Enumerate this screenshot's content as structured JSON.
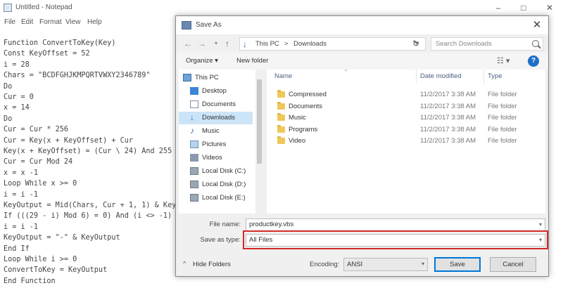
{
  "notepad": {
    "title": "Untitled - Notepad",
    "menu": [
      "File",
      "Edit",
      "Format",
      "View",
      "Help"
    ],
    "code_lines": [
      "Function ConvertToKey(Key)",
      "Const KeyOffset = 52",
      "i = 28",
      "Chars = \"BCDFGHJKMPQRTVWXY2346789\"",
      "Do",
      "Cur = 0",
      "x = 14",
      "Do",
      "Cur = Cur * 256",
      "Cur = Key(x + KeyOffset) + Cur",
      "Key(x + KeyOffset) = (Cur \\ 24) And 255",
      "Cur = Cur Mod 24",
      "x = x -1",
      "Loop While x >= 0",
      "i = i -1",
      "KeyOutput = Mid(Chars, Cur + 1, 1) & KeyOutput",
      "If (((29 - i) Mod 6) = 0) And (i <> -1) Then",
      "i = i -1",
      "KeyOutput = \"-\" & KeyOutput",
      "End If",
      "Loop While i >= 0",
      "ConvertToKey = KeyOutput",
      "End Function"
    ]
  },
  "dialog": {
    "title": "Save As",
    "address": {
      "crumbs": [
        "This PC",
        ">",
        "Downloads"
      ],
      "search_placeholder": "Search Downloads"
    },
    "toolbar": {
      "organize": "Organize ▾",
      "new_folder": "New folder",
      "help": "?"
    },
    "nav_items": [
      {
        "label": "This PC",
        "icon": "computer-icon",
        "selected": false
      },
      {
        "label": "Desktop",
        "icon": "desktop-icon",
        "selected": false
      },
      {
        "label": "Documents",
        "icon": "documents-icon",
        "selected": false
      },
      {
        "label": "Downloads",
        "icon": "download-icon",
        "selected": true
      },
      {
        "label": "Music",
        "icon": "music-icon",
        "selected": false
      },
      {
        "label": "Pictures",
        "icon": "pictures-icon",
        "selected": false
      },
      {
        "label": "Videos",
        "icon": "videos-icon",
        "selected": false
      },
      {
        "label": "Local Disk (C:)",
        "icon": "disk-icon",
        "selected": false
      },
      {
        "label": "Local Disk (D:)",
        "icon": "disk-icon",
        "selected": false
      },
      {
        "label": "Local Disk (E:)",
        "icon": "disk-icon",
        "selected": false
      }
    ],
    "columns": {
      "name": "Name",
      "date": "Date modified",
      "type": "Type"
    },
    "files": [
      {
        "name": "Compressed",
        "date": "11/2/2017 3:38 AM",
        "type": "File folder"
      },
      {
        "name": "Documents",
        "date": "11/2/2017 3:38 AM",
        "type": "File folder"
      },
      {
        "name": "Music",
        "date": "11/2/2017 3:38 AM",
        "type": "File folder"
      },
      {
        "name": "Programs",
        "date": "11/2/2017 3:38 AM",
        "type": "File folder"
      },
      {
        "name": "Video",
        "date": "11/2/2017 3:38 AM",
        "type": "File folder"
      }
    ],
    "file_name_label": "File name:",
    "file_name_value": "productkey.vbs",
    "save_type_label": "Save as type:",
    "save_type_value": "All Files",
    "hide_folders": "Hide Folders",
    "encoding_label": "Encoding:",
    "encoding_value": "ANSI",
    "save_button": "Save",
    "cancel_button": "Cancel",
    "highlight_color": "#d42a2a",
    "selection_color": "#cce4f7"
  }
}
